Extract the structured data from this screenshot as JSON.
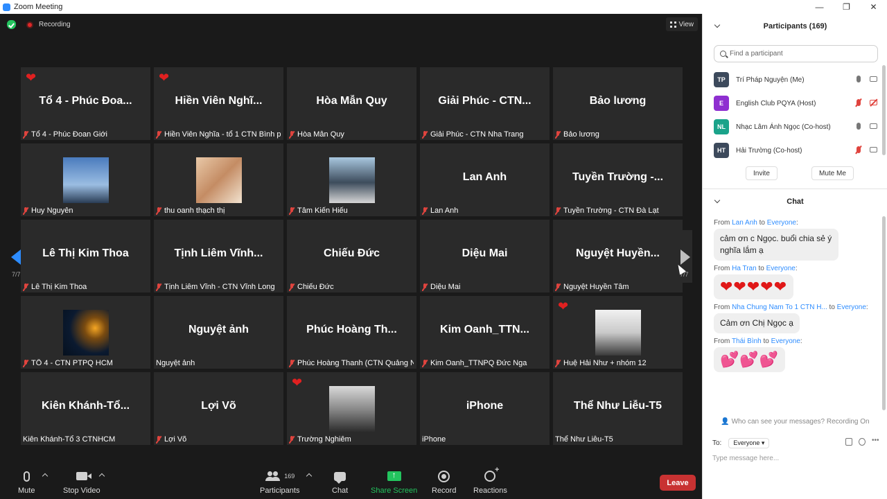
{
  "window": {
    "title": "Zoom Meeting",
    "controls": [
      "—",
      "❐",
      "✕"
    ]
  },
  "meeting": {
    "recording_label": "Recording",
    "view_label": "View",
    "page_indicator": "7/7"
  },
  "tiles": [
    {
      "display": "Tổ 4 - Phúc Đoa...",
      "caption": "Tổ 4 - Phúc Đoan Giới",
      "muted": true,
      "heart": true
    },
    {
      "display": "Hiền Viên Nghĩ...",
      "caption": "Hiền Viên Nghĩa - tổ 1 CTN Bình p...",
      "muted": true,
      "heart": true
    },
    {
      "display": "Hòa Mẫn Quy",
      "caption": "Hòa Mẫn Quy",
      "muted": true
    },
    {
      "display": "Giải Phúc - CTN...",
      "caption": "Giải Phúc - CTN Nha Trang",
      "muted": true
    },
    {
      "display": "Bảo lương",
      "caption": "Bảo lương",
      "muted": true
    },
    {
      "photo": "ph-sky",
      "caption": "Huy Nguyên",
      "muted": true
    },
    {
      "photo": "ph-girl",
      "caption": "thu oanh thạch thị",
      "muted": true
    },
    {
      "photo": "ph-man",
      "caption": "Tâm Kiến Hiếu",
      "muted": true
    },
    {
      "display": "Lan Anh",
      "caption": "Lan Anh",
      "muted": true
    },
    {
      "display": "Tuyền Trường -...",
      "caption": "Tuyền Trường - CTN Đà Lạt",
      "muted": true
    },
    {
      "display": "Lê Thị Kim Thoa",
      "caption": "Lê Thị Kim Thoa",
      "muted": true
    },
    {
      "display": "Tịnh Liêm Vĩnh...",
      "caption": "Tịnh Liêm Vĩnh - CTN Vĩnh Long",
      "muted": true
    },
    {
      "display": "Chiếu Đức",
      "caption": "Chiếu Đức",
      "muted": true
    },
    {
      "display": "Diệu Mai",
      "caption": "Diệu Mai",
      "muted": true
    },
    {
      "display": "Nguyệt  Huyền...",
      "caption": "Nguyệt  Huyền Tâm",
      "muted": true
    },
    {
      "photo": "ph-space",
      "caption": "TỔ 4 - CTN PTPQ HCM",
      "muted": true
    },
    {
      "display": "Nguyệt ảnh",
      "caption": "Nguyệt ảnh",
      "muted": false
    },
    {
      "display": "Phúc Hoàng Th...",
      "caption": "Phúc Hoàng Thanh (CTN Quảng N...",
      "muted": true
    },
    {
      "display": "Kim  Oanh_TTN...",
      "caption": "Kim Oanh_TTNPQ Đức Nga",
      "muted": true
    },
    {
      "photo": "ph-sit",
      "caption": "Huệ Hải Như + nhóm 12",
      "muted": true,
      "heart": true
    },
    {
      "display": "Kiên  Khánh-Tổ...",
      "caption": "Kiên Khánh-Tổ 3 CTNHCM",
      "muted": false
    },
    {
      "display": "Lợi Võ",
      "caption": "Lợi Võ",
      "muted": true
    },
    {
      "photo": "ph-bw",
      "caption": "Trường Nghiêm",
      "muted": true,
      "heart": true
    },
    {
      "display": "iPhone",
      "caption": "iPhone",
      "muted": false
    },
    {
      "display": "Thể Như Liễu-T5",
      "caption": "Thể Như Liễu-T5",
      "muted": false
    }
  ],
  "toolbar": {
    "mute": "Mute",
    "stop_video": "Stop Video",
    "participants": "Participants",
    "participants_count": "169",
    "chat": "Chat",
    "share_screen": "Share Screen",
    "record": "Record",
    "reactions": "Reactions",
    "leave": "Leave"
  },
  "participants_panel": {
    "title": "Participants (169)",
    "search_placeholder": "Find a participant",
    "list": [
      {
        "initials": "TP",
        "name": "Trí Pháp Nguyện (Me)",
        "color": "#3d4a5c",
        "mic_off": false,
        "cam_off": false
      },
      {
        "initials": "E",
        "name": "English Club PQYA (Host)",
        "color": "#8e2fd0",
        "mic_off": true,
        "cam_off": true
      },
      {
        "initials": "NL",
        "name": "Nhạc Lâm Ánh Ngọc (Co-host)",
        "color": "#1aa38a",
        "mic_off": false,
        "cam_off": false
      },
      {
        "initials": "HT",
        "name": "Hải Trường (Co-host)",
        "color": "#3d4a5c",
        "mic_off": true,
        "cam_off": false
      }
    ],
    "invite": "Invite",
    "mute_me": "Mute Me"
  },
  "chat_panel": {
    "title": "Chat",
    "messages": [
      {
        "from_prefix": "From ",
        "sender": "Lan Anh",
        "to": " to ",
        "recipient": "Everyone",
        "suffix": ":",
        "text": "cảm ơn c Ngọc. buổi chia sẻ ý nghĩa lắm ạ"
      },
      {
        "from_prefix": "From ",
        "sender": "Ha Tran",
        "to": " to ",
        "recipient": "Everyone",
        "suffix": ":",
        "text": "❤❤❤❤❤"
      },
      {
        "from_prefix": "From ",
        "sender": "Nha Chung Nam To 1 CTN H...",
        "to": " to ",
        "recipient": "Everyone",
        "suffix": ":",
        "text": "Cảm ơn Chị Ngọc ạ"
      },
      {
        "from_prefix": "From ",
        "sender": "Thái Bình",
        "to": " to ",
        "recipient": "Everyone",
        "suffix": ":",
        "text": "💕💕💕"
      }
    ],
    "privacy_note": "Who can see your messages? Recording On",
    "to_label": "To:",
    "to_value": "Everyone",
    "input_placeholder": "Type message here..."
  }
}
